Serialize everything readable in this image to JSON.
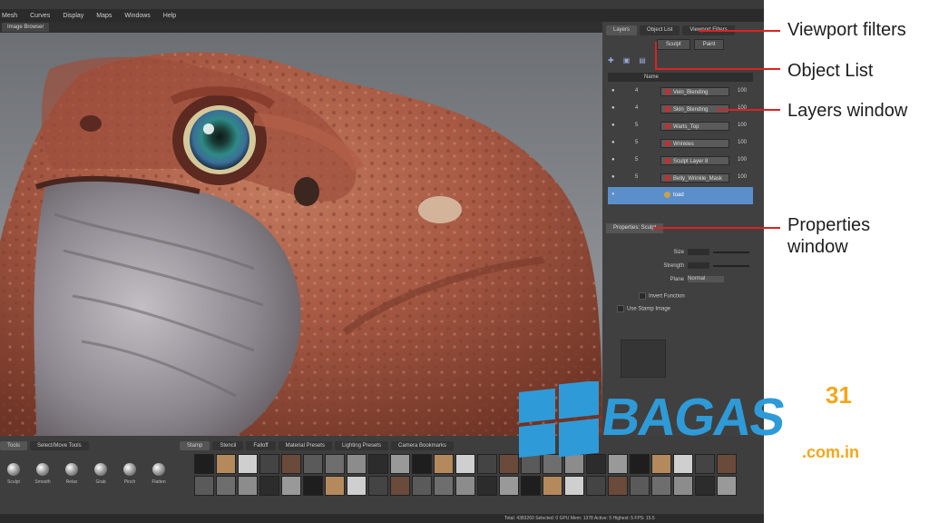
{
  "menu": [
    "Mesh",
    "Curves",
    "Display",
    "Maps",
    "Windows",
    "Help"
  ],
  "image_browser_tab": "Image Browser",
  "right_tabs": [
    "Layers",
    "Object List",
    "Viewport Filters"
  ],
  "sub_tabs": [
    "Sculpt",
    "Paint"
  ],
  "layer_columns": {
    "name": "Name"
  },
  "layers": [
    {
      "num": "4",
      "name": "Vein_Blending",
      "opacity": "100",
      "kind": "folder"
    },
    {
      "num": "4",
      "name": "Skin_Blending",
      "opacity": "100",
      "kind": "folder"
    },
    {
      "num": "5",
      "name": "Warts_Top",
      "opacity": "100",
      "kind": "layer"
    },
    {
      "num": "5",
      "name": "Wrinkles",
      "opacity": "100",
      "kind": "layer"
    },
    {
      "num": "5",
      "name": "Sculpt Layer 8",
      "opacity": "100",
      "kind": "layer"
    },
    {
      "num": "5",
      "name": "Belly_Wrinkle_Mask",
      "opacity": "100",
      "kind": "layer"
    },
    {
      "num": "",
      "name": "toad",
      "opacity": "",
      "kind": "object",
      "selected": true
    }
  ],
  "properties_title": "Properties: Sculpt",
  "properties": [
    {
      "label": "Size",
      "value": "25"
    },
    {
      "label": "Strength",
      "value": "25"
    },
    {
      "label": "Plane",
      "value": "Normal"
    }
  ],
  "checks": [
    "Invert Function",
    "Use Stamp Image"
  ],
  "bottom_left_tabs": [
    "Tools",
    "Select/Move Tools"
  ],
  "tools": [
    "Sculpt",
    "Smooth",
    "Relax",
    "Grab",
    "Pinch",
    "Flatten"
  ],
  "bottom_tabs": [
    "Stamp",
    "Stencil",
    "Falloff",
    "Material Presets",
    "Lighting Presets",
    "Camera Bookmarks"
  ],
  "status": "Total: 4383260  Selected: 0  GPU Mem: 1378  Active: 5  Highest: 5  FPS: 15.5",
  "callouts": [
    "Viewport filters",
    "Object List",
    "Layers window",
    "Properties window"
  ],
  "watermark": {
    "brand": "BAGAS",
    "sup": "31",
    "domain": ".com.in"
  },
  "colors": {
    "accent_red": "#d22222",
    "selection_blue": "#5b8fcc",
    "watermark_blue": "#2e9bd8",
    "watermark_orange": "#f2a71b"
  }
}
